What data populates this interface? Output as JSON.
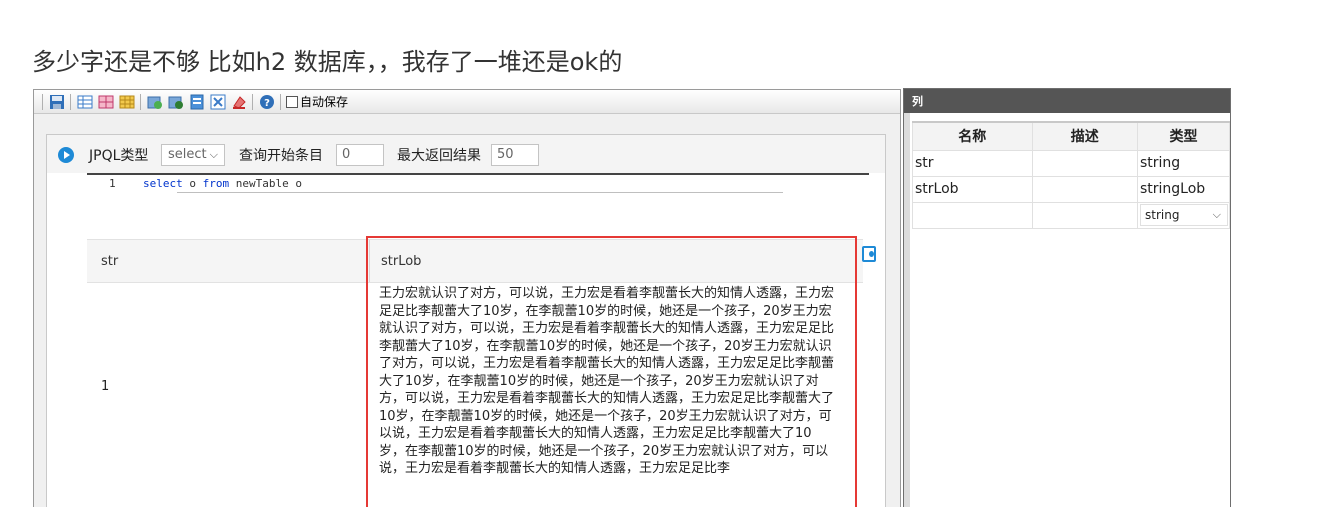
{
  "page": {
    "heading": "多少字还是不够 比如h2 数据库，，我存了一堆还是ok的"
  },
  "toolbar": {
    "icons": [
      "save-icon",
      "table-icon",
      "grid-icon",
      "db-icon",
      "refresh-icon",
      "import-icon",
      "sql-icon",
      "excel-icon",
      "delete-icon",
      "help-icon"
    ],
    "autosave_label": "自动保存"
  },
  "query": {
    "type_label": "JPQL类型",
    "type_value": "select",
    "start_label": "查询开始条目",
    "start_value": "0",
    "max_label": "最大返回结果",
    "max_value": "50"
  },
  "editor": {
    "line_number": "1",
    "kw_select": "select",
    "text_o": " o ",
    "kw_from": "from",
    "text_rest": " newTable o"
  },
  "results": {
    "columns": [
      "str",
      "strLob"
    ],
    "rows": [
      {
        "str": "1",
        "strLob": "王力宏就认识了对方，可以说，王力宏是看着李靓蕾长大的知情人透露，王力宏足足比李靓蕾大了10岁，在李靓蕾10岁的时候，她还是一个孩子，20岁王力宏就认识了对方，可以说，王力宏是看着李靓蕾长大的知情人透露，王力宏足足比李靓蕾大了10岁，在李靓蕾10岁的时候，她还是一个孩子，20岁王力宏就认识了对方，可以说，王力宏是看着李靓蕾长大的知情人透露，王力宏足足比李靓蕾大了10岁，在李靓蕾10岁的时候，她还是一个孩子，20岁王力宏就认识了对方，可以说，王力宏是看着李靓蕾长大的知情人透露，王力宏足足比李靓蕾大了10岁，在李靓蕾10岁的时候，她还是一个孩子，20岁王力宏就认识了对方，可以说，王力宏是看着李靓蕾长大的知情人透露，王力宏足足比李靓蕾大了10岁，在李靓蕾10岁的时候，她还是一个孩子，20岁王力宏就认识了对方，可以说，王力宏是看着李靓蕾长大的知情人透露，王力宏足足比李"
      }
    ]
  },
  "column_panel": {
    "title": "列",
    "headers": [
      "名称",
      "描述",
      "类型"
    ],
    "rows": [
      {
        "name": "str",
        "desc": "",
        "type": "string"
      },
      {
        "name": "strLob",
        "desc": "",
        "type": "stringLob"
      }
    ],
    "new_type_value": "string"
  },
  "colors": {
    "accent": "#1e8ad6",
    "highlight": "#e53935",
    "titlebar": "#555555"
  }
}
